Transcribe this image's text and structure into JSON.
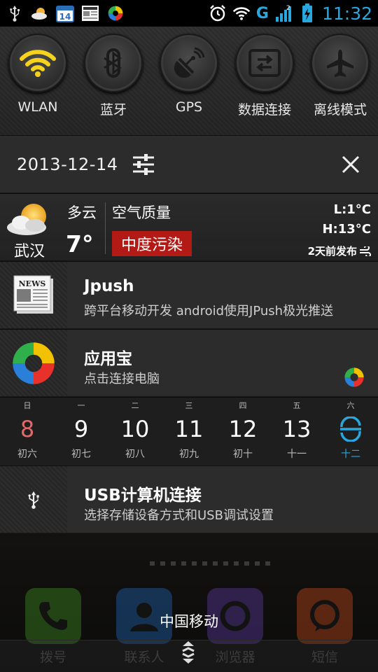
{
  "status_bar": {
    "time": "11:32",
    "network": "G",
    "sim_slot": "2",
    "calendar_day": "14",
    "icons": [
      "usb-icon",
      "weather-icon",
      "calendar-icon",
      "news-icon",
      "app-store-icon",
      "alarm-icon",
      "wifi-icon",
      "signal-icon",
      "battery-charging-icon"
    ]
  },
  "quick_settings": {
    "tiles": [
      {
        "label": "WLAN",
        "icon": "wifi-icon",
        "active": true
      },
      {
        "label": "蓝牙",
        "icon": "bluetooth-icon",
        "active": false
      },
      {
        "label": "GPS",
        "icon": "gps-icon",
        "active": false
      },
      {
        "label": "数据连接",
        "icon": "data-connection-icon",
        "active": false
      },
      {
        "label": "离线模式",
        "icon": "airplane-icon",
        "active": false
      }
    ],
    "page_index": 2,
    "page_count": 4
  },
  "header": {
    "date": "2013-12-14"
  },
  "weather": {
    "city": "武汉",
    "condition": "多云",
    "temperature": "7°",
    "air_quality_label": "空气质量",
    "air_quality_value": "中度污染",
    "low": "L:1°C",
    "high": "H:13°C",
    "published": "2天前发布"
  },
  "notifications": [
    {
      "title": "Jpush",
      "subtitle": "跨平台移动开发 android使用JPush极光推送",
      "icon": "news-icon"
    },
    {
      "title": "应用宝",
      "subtitle": "点击连接电脑",
      "icon": "app-store-icon"
    },
    {
      "title": "USB计算机连接",
      "subtitle": "选择存储设备方式和USB调试设置",
      "icon": "usb-icon"
    }
  ],
  "calendar": {
    "days": [
      {
        "weekday": "日",
        "date": "8",
        "lunar": "初六"
      },
      {
        "weekday": "一",
        "date": "9",
        "lunar": "初七"
      },
      {
        "weekday": "二",
        "date": "10",
        "lunar": "初八"
      },
      {
        "weekday": "三",
        "date": "11",
        "lunar": "初九"
      },
      {
        "weekday": "四",
        "date": "12",
        "lunar": "初十"
      },
      {
        "weekday": "五",
        "date": "13",
        "lunar": "十一"
      },
      {
        "weekday": "六",
        "date": "",
        "lunar": "十二"
      }
    ],
    "today_index": 6
  },
  "home": {
    "carrier": "中国移动",
    "dock_apps": [
      {
        "label": "拨号",
        "color": "#3f8f1f"
      },
      {
        "label": "联系人",
        "color": "#1f65b5"
      },
      {
        "label": "浏览器",
        "color": "#5d3aa3"
      },
      {
        "label": "短信",
        "color": "#c44a1a"
      }
    ]
  },
  "colors": {
    "accent": "#29a8e0",
    "pollution_badge": "#b31a15",
    "sunday": "#e06a6a"
  }
}
